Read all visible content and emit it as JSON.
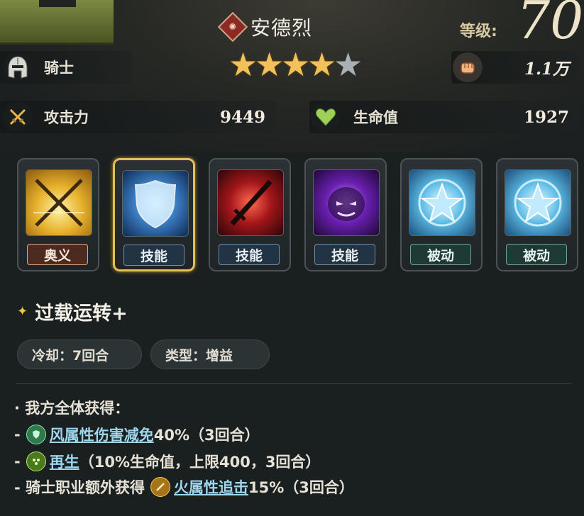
{
  "hero": {
    "name": "安德烈",
    "name_gem_glyph": "✺",
    "level_label": "等级:",
    "level": "70",
    "stars_filled": 4,
    "stars_total": 5,
    "class_name": "骑士",
    "power_value": "1.1万"
  },
  "stats": {
    "attack_label": "攻击力",
    "attack_value": "9449",
    "hp_label": "生命值",
    "hp_value": "1927"
  },
  "skills": [
    {
      "tag": "奥义",
      "kind": "ult",
      "image": "crossed-swords-icon"
    },
    {
      "tag": "技能",
      "kind": "skill",
      "image": "shield-icon",
      "selected": true
    },
    {
      "tag": "技能",
      "kind": "skill",
      "image": "flaming-sword-icon"
    },
    {
      "tag": "技能",
      "kind": "skill",
      "image": "ghost-icon"
    },
    {
      "tag": "被动",
      "kind": "passive",
      "image": "star-icon"
    },
    {
      "tag": "被动",
      "kind": "passive",
      "image": "star-icon"
    }
  ],
  "selected_skill": {
    "name": "过载运转+",
    "cooldown": "冷却：7回合",
    "type": "类型：增益"
  },
  "description": {
    "line1": "· 我方全体获得：",
    "line2_prefix": "- ",
    "line2_link": "风属性伤害减免",
    "line2_rest": "40%（3回合）",
    "line3_prefix": "- ",
    "line3_link": "再生",
    "line3_rest": "（10%生命值，上限400，3回合）",
    "line4_prefix": "- 骑士职业额外获得",
    "line4_link": "火属性追击",
    "line4_rest": "15%（3回合）"
  },
  "colors": {
    "accent_gold": "#e6bd5a",
    "link": "#9fd6ee",
    "star": "#f3c15a"
  }
}
